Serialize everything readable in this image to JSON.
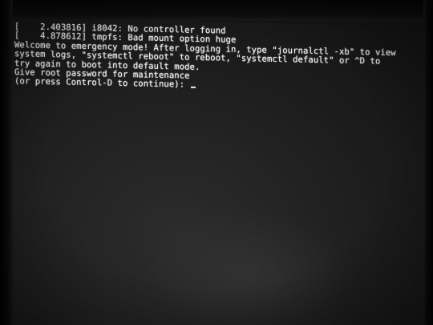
{
  "console": {
    "lines": [
      "[    2.403816] i8042: No controller found",
      "[    4.878612] tmpfs: Bad mount option huge",
      "Welcome to emergency mode! After logging in, type \"journalctl -xb\" to view",
      "system logs, \"systemctl reboot\" to reboot, \"systemctl default\" or ^D to",
      "try again to boot into default mode.",
      "Give root password for maintenance",
      "(or press Control-D to continue): "
    ]
  },
  "colors": {
    "text": "#f2f2f2",
    "screen_background": "#232323",
    "bezel": "#050505"
  }
}
